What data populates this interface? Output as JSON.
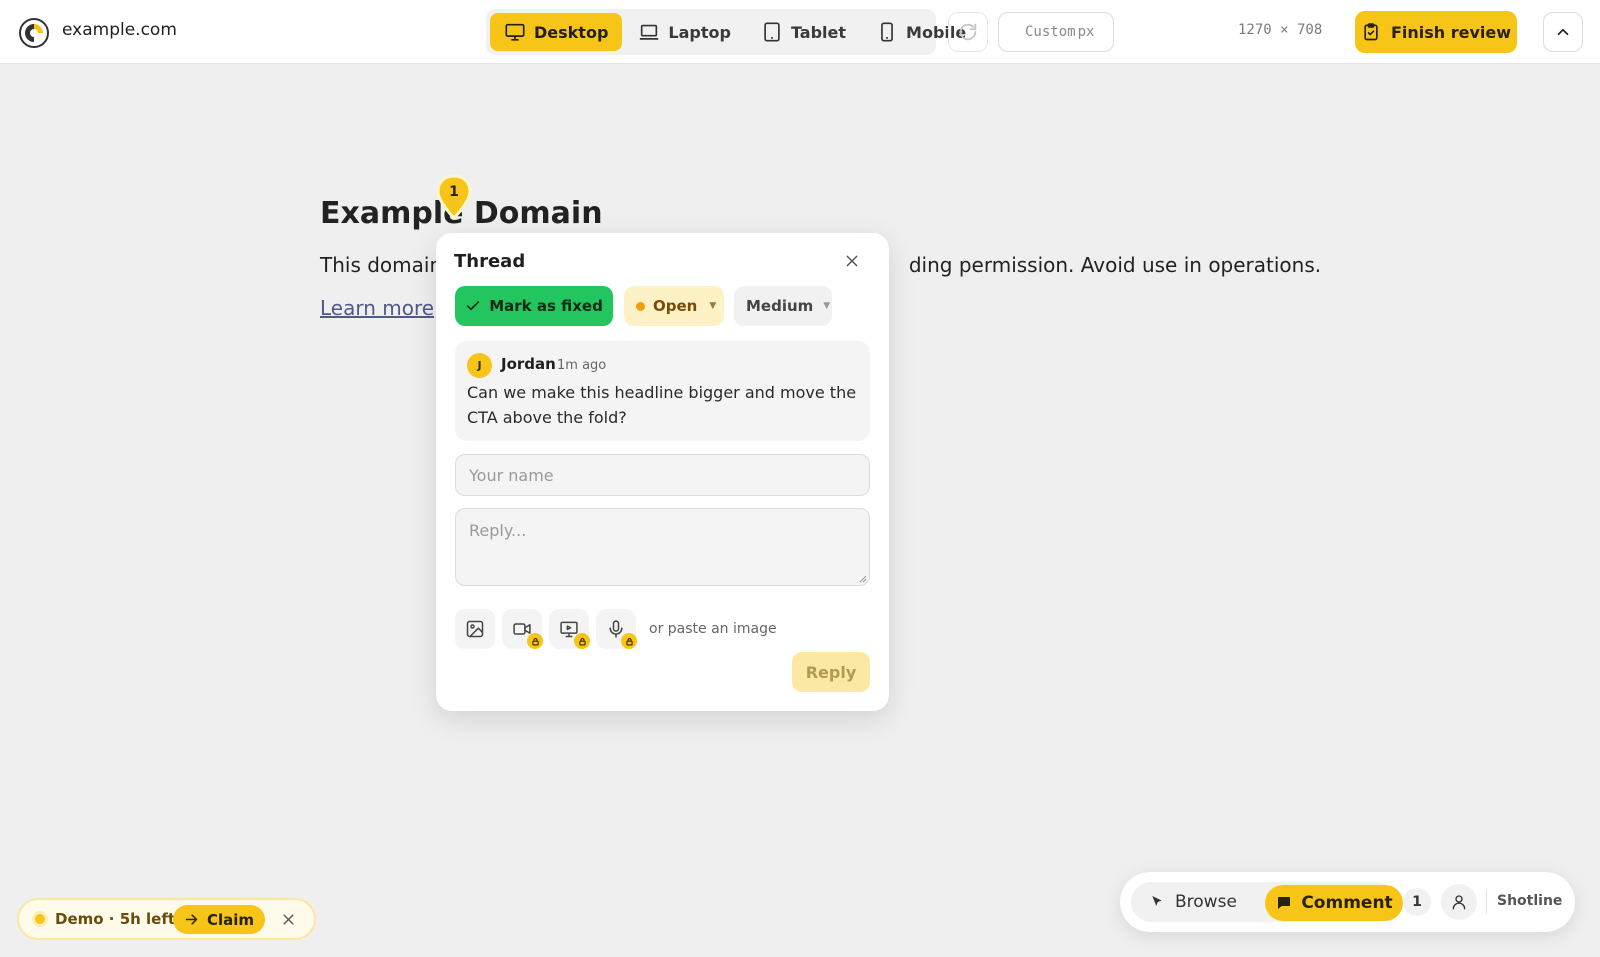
{
  "topbar": {
    "site": "example.com",
    "devices": [
      {
        "label": "Desktop",
        "active": true
      },
      {
        "label": "Laptop",
        "active": false
      },
      {
        "label": "Tablet",
        "active": false
      },
      {
        "label": "Mobile",
        "active": false
      }
    ],
    "custom_placeholder": "Custom",
    "custom_unit": "px",
    "dimensions": "1270 × 708",
    "finish_label": "Finish review"
  },
  "page": {
    "title": "Example Domain",
    "paragraph_start": "This domain",
    "paragraph_end": "ding permission. Avoid use in operations.",
    "link": "Learn more"
  },
  "pin": {
    "number": "1"
  },
  "thread": {
    "title": "Thread",
    "mark_fixed_label": "Mark as fixed",
    "status": "Open",
    "priority": "Medium",
    "comment": {
      "avatar_initial": "J",
      "author": "Jordan",
      "time": "1m ago",
      "text": "Can we make this headline bigger and move the CTA above the fold?"
    },
    "name_placeholder": "Your name",
    "reply_placeholder": "Reply...",
    "paste_hint": "or paste an image",
    "reply_label": "Reply"
  },
  "demo": {
    "text": "Demo · 5h left",
    "claim_label": "Claim"
  },
  "modebar": {
    "browse_label": "Browse",
    "comment_label": "Comment",
    "count": "1",
    "brand": "Shotline"
  },
  "colors": {
    "accent": "#f7c518",
    "success": "#22c55e",
    "status_open": "#f59e0b"
  }
}
